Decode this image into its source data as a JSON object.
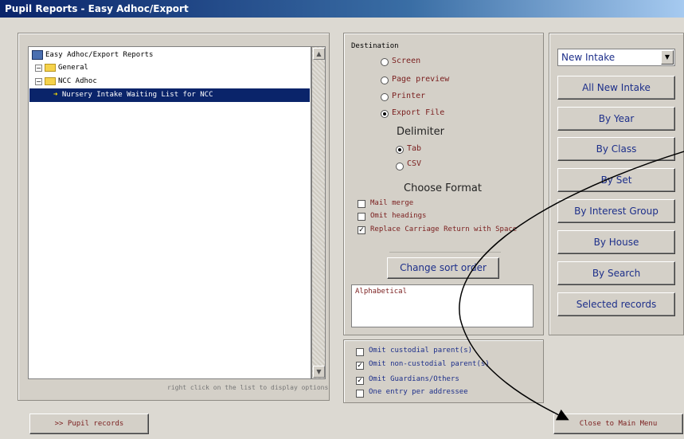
{
  "window": {
    "title": "Pupil Reports - Easy Adhoc/Export"
  },
  "tree": {
    "root": "Easy Adhoc/Export Reports",
    "items": [
      {
        "label": "General"
      },
      {
        "label": "NCC Adhoc"
      },
      {
        "label": "Nursery Intake Waiting List for NCC"
      }
    ],
    "hint": "right click on the list to display options"
  },
  "destination": {
    "heading": "Destination",
    "options": [
      "Screen",
      "Page preview",
      "Printer",
      "Export File"
    ],
    "selected": "Export File",
    "delimiter_label": "Delimiter",
    "delimiters": [
      "Tab",
      "CSV"
    ],
    "delimiter_selected": "Tab",
    "format_label": "Choose Format",
    "format_checks": [
      {
        "label": "Mail merge",
        "checked": false
      },
      {
        "label": "Omit headings",
        "checked": false
      },
      {
        "label": "Replace Carriage Return with Space",
        "checked": true
      }
    ],
    "sort_button": "Change sort order",
    "sort_value": "Alphabetical"
  },
  "omit_options": [
    {
      "label": "Omit custodial parent(s)",
      "checked": false
    },
    {
      "label": "Omit non-custodial parent(s)",
      "checked": true
    },
    {
      "label": "Omit Guardians/Others",
      "checked": true
    },
    {
      "label": "One entry per addressee",
      "checked": false
    }
  ],
  "selection": {
    "dropdown_value": "New Intake",
    "buttons": [
      "All New Intake",
      "By Year",
      "By Class",
      "By Set",
      "By Interest Group",
      "By House",
      "By Search",
      "Selected records"
    ]
  },
  "footer": {
    "left_button": ">> Pupil records",
    "right_button": "Close to Main Menu"
  }
}
